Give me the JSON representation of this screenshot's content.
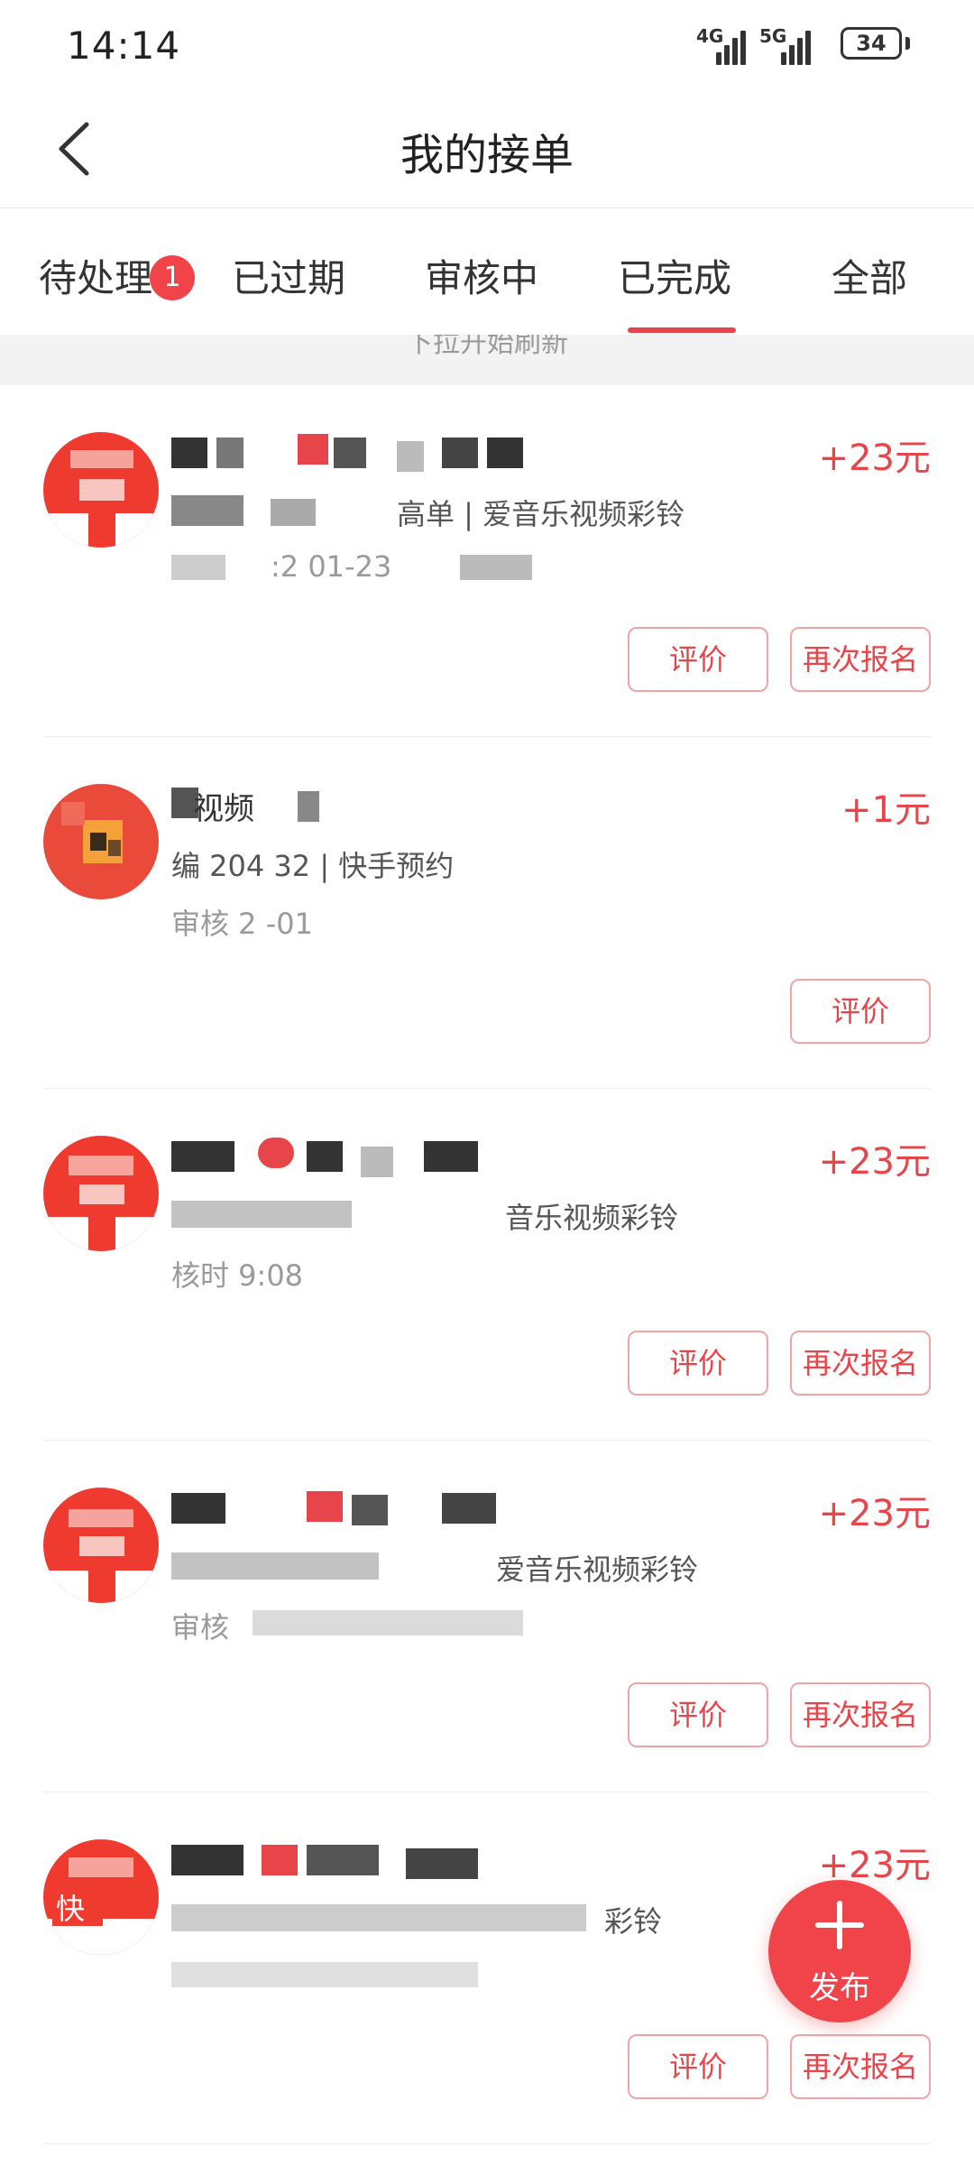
{
  "status_bar": {
    "time": "14:14",
    "signal_1_label": "4G",
    "signal_2_label": "5G",
    "battery": "34"
  },
  "header": {
    "title": "我的接单",
    "back_icon": "chevron-left-icon"
  },
  "tabs": [
    {
      "label": "待处理",
      "badge": "1"
    },
    {
      "label": "已过期"
    },
    {
      "label": "审核中"
    },
    {
      "label": "已完成",
      "active": true
    },
    {
      "label": "全部"
    }
  ],
  "refresh_hint": "下拉开始刷新",
  "orders": [
    {
      "name": "",
      "sub_visible": "高单 | 爱音乐视频彩铃",
      "meta_visible": ":2    01-23",
      "amount": "+23元",
      "buttons": [
        "评价",
        "再次报名"
      ]
    },
    {
      "name": "视频",
      "sub_visible": "编     204    32 |      快手预约",
      "meta_visible": "审核    2     -01",
      "amount": "+1元",
      "buttons": [
        "评价"
      ]
    },
    {
      "name": "",
      "sub_visible": "音乐视频彩铃",
      "meta_visible": "核时                   9:08",
      "amount": "+23元",
      "buttons": [
        "评价",
        "再次报名"
      ]
    },
    {
      "name": "",
      "sub_visible": "爱音乐视频彩铃",
      "meta_visible": "审核",
      "amount": "+23元",
      "buttons": [
        "评价",
        "再次报名"
      ]
    },
    {
      "name": "",
      "sub_visible": "彩铃",
      "meta_visible": "",
      "amount": "+23元",
      "buttons": [
        "评价",
        "再次报名"
      ],
      "avatar_badge": "快"
    }
  ],
  "fab": {
    "icon": "plus-icon",
    "label": "发布"
  },
  "colors": {
    "accent": "#e8454a",
    "badge": "#f0444a",
    "button_border": "#f0a4a6"
  }
}
